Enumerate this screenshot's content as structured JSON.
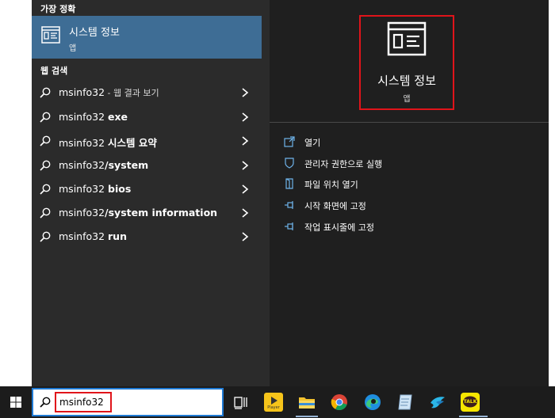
{
  "sections": {
    "best_match_label": "가장 정확",
    "web_label": "웹 검색"
  },
  "best_match": {
    "title": "시스템 정보",
    "subtitle": "앱",
    "icon": "system-info-icon"
  },
  "web_results": [
    {
      "query": "msinfo32",
      "suffix": "",
      "hint": " - 웹 결과 보기"
    },
    {
      "query": "msinfo32 ",
      "suffix": "exe",
      "hint": ""
    },
    {
      "query": "msinfo32 ",
      "suffix": "시스템 요약",
      "hint": ""
    },
    {
      "query": "msinfo32",
      "suffix": "/system",
      "hint": ""
    },
    {
      "query": "msinfo32 ",
      "suffix": "bios",
      "hint": ""
    },
    {
      "query": "msinfo32",
      "suffix": "/system information",
      "hint": ""
    },
    {
      "query": "msinfo32 ",
      "suffix": "run",
      "hint": ""
    }
  ],
  "app_preview": {
    "title": "시스템 정보",
    "subtitle": "앱"
  },
  "actions": [
    {
      "label": "열기",
      "icon": "open-icon"
    },
    {
      "label": "관리자 권한으로 실행",
      "icon": "run-as-admin-icon"
    },
    {
      "label": "파일 위치 열기",
      "icon": "file-location-icon"
    },
    {
      "label": "시작 화면에 고정",
      "icon": "pin-start-icon"
    },
    {
      "label": "작업 표시줄에 고정",
      "icon": "pin-taskbar-icon"
    }
  ],
  "taskbar": {
    "search_value": "msinfo32",
    "apps": [
      "task-view-icon",
      "player-icon",
      "file-explorer-icon",
      "chrome-icon",
      "edge-icon",
      "notepad-icon",
      "bird-app-icon",
      "kakaotalk-icon"
    ],
    "kakaotalk_label": "TALK",
    "player_label": "Player"
  },
  "colors": {
    "accent": "#3e6d95",
    "highlight_border": "#e0141a",
    "search_border": "#1f7ad4",
    "left_bg": "#2b2b2b",
    "right_bg": "#1f1f1f",
    "taskbar_bg": "#1c1c1c"
  }
}
